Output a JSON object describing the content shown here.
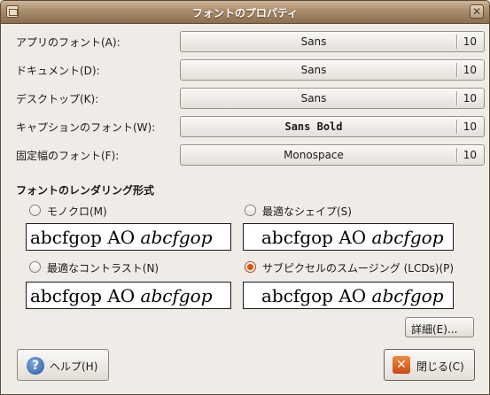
{
  "window": {
    "title": "フォントのプロパティ",
    "close_glyph": "✕"
  },
  "fonts": [
    {
      "label": "アプリのフォント(A):",
      "family": "Sans",
      "size": "10",
      "bold": false
    },
    {
      "label": "ドキュメント(D):",
      "family": "Sans",
      "size": "10",
      "bold": false
    },
    {
      "label": "デスクトップ(K):",
      "family": "Sans",
      "size": "10",
      "bold": false
    },
    {
      "label": "キャプションのフォント(W):",
      "family": "Sans Bold",
      "size": "10",
      "bold": true
    },
    {
      "label": "固定幅のフォント(F):",
      "family": "Monospace",
      "size": "10",
      "bold": false
    }
  ],
  "rendering": {
    "title": "フォントのレンダリング形式",
    "sample_regular": "abcfgop AO ",
    "sample_italic": "abcfgop",
    "options": [
      {
        "label": "モノクロ(M)",
        "checked": false
      },
      {
        "label": "最適なシェイプ(S)",
        "checked": false
      },
      {
        "label": "最適なコントラスト(N)",
        "checked": false
      },
      {
        "label": "サブピクセルのスムージング (LCDs)(P)",
        "checked": true
      }
    ]
  },
  "buttons": {
    "details": "詳細(E)...",
    "help": "ヘルプ(H)",
    "close": "閉じる(C)",
    "help_glyph": "?",
    "close_glyph": "✕"
  },
  "colors": {
    "accent_radio": "#e0530f",
    "titlebar": "#a88c6b"
  }
}
